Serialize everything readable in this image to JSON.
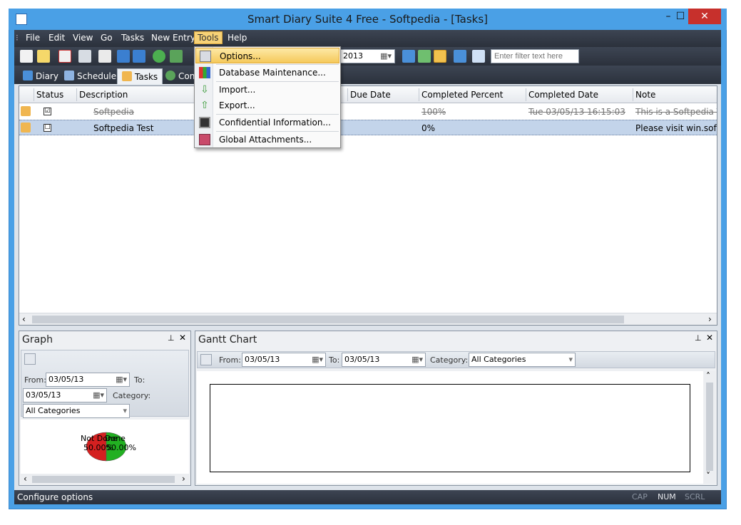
{
  "window": {
    "title": "Smart Diary Suite 4 Free - Softpedia - [Tasks]",
    "minimize": "–",
    "maximize": "☐",
    "close": "✕"
  },
  "menu": {
    "items": [
      "File",
      "Edit",
      "View",
      "Go",
      "Tasks",
      "New Entry",
      "Tools",
      "Help"
    ],
    "active": "Tools"
  },
  "toolbar": {
    "date_value": "2013",
    "filter_placeholder": "Enter filter text here"
  },
  "tabs": [
    {
      "label": "Diary"
    },
    {
      "label": "Schedule"
    },
    {
      "label": "Tasks"
    },
    {
      "label": "Con"
    }
  ],
  "grid": {
    "columns": [
      "Status",
      "Description",
      "Due Date",
      "Completed Percent",
      "Completed Date",
      "Note"
    ],
    "rows": [
      {
        "status_checked": "☑",
        "description": "Softpedia",
        "due": "",
        "percent": "100%",
        "completed": "Tue 03/05/13 16:15:03",
        "note": "This is a Softpedia Tes",
        "done": true
      },
      {
        "status_checked": "☐",
        "description": "Softpedia Test",
        "due": "",
        "percent": "0%",
        "completed": "",
        "note": "Please visit win.softpe",
        "done": false
      }
    ]
  },
  "tools_menu": {
    "items": [
      {
        "label": "Options...",
        "icon": "wrench-scissors-icon"
      },
      {
        "label": "Database Maintenance...",
        "icon": "database-chart-icon"
      },
      {
        "label": "Import...",
        "icon": "arrow-down-icon"
      },
      {
        "label": "Export...",
        "icon": "arrow-up-icon"
      },
      {
        "label": "Confidential Information...",
        "icon": "safe-icon"
      },
      {
        "label": "Global Attachments...",
        "icon": "paperclip-icon"
      }
    ]
  },
  "graph": {
    "title": "Graph",
    "from_label": "From:",
    "from_value": "03/05/13",
    "to_label": "To:",
    "to_value": "03/05/13",
    "category_label": "Category:",
    "category_value": "All Categories",
    "pie_label_left": "Not Done",
    "pie_value_left": "50.00%",
    "pie_label_right": "Done",
    "pie_value_right": "50.00%"
  },
  "gantt": {
    "title": "Gantt Chart",
    "from_label": "From:",
    "from_value": "03/05/13",
    "to_label": "To:",
    "to_value": "03/05/13",
    "category_label": "Category:",
    "category_value": "All Categories"
  },
  "status": {
    "text": "Configure options",
    "cap": "CAP",
    "num": "NUM",
    "scrl": "SCRL"
  },
  "colors": {
    "titlebar": "#4aa0e6",
    "menu_bg": "#2b313c",
    "highlight": "#f5c95a",
    "selected_row": "#c3d4ea",
    "pie_red": "#d42020",
    "pie_green": "#22b022"
  },
  "chrome": {
    "pin": "⊥",
    "close": "✕",
    "scroll_left": "‹",
    "scroll_right": "›",
    "scroll_up": "˄",
    "scroll_down": "˅",
    "dropdown_arrow": "▾"
  }
}
